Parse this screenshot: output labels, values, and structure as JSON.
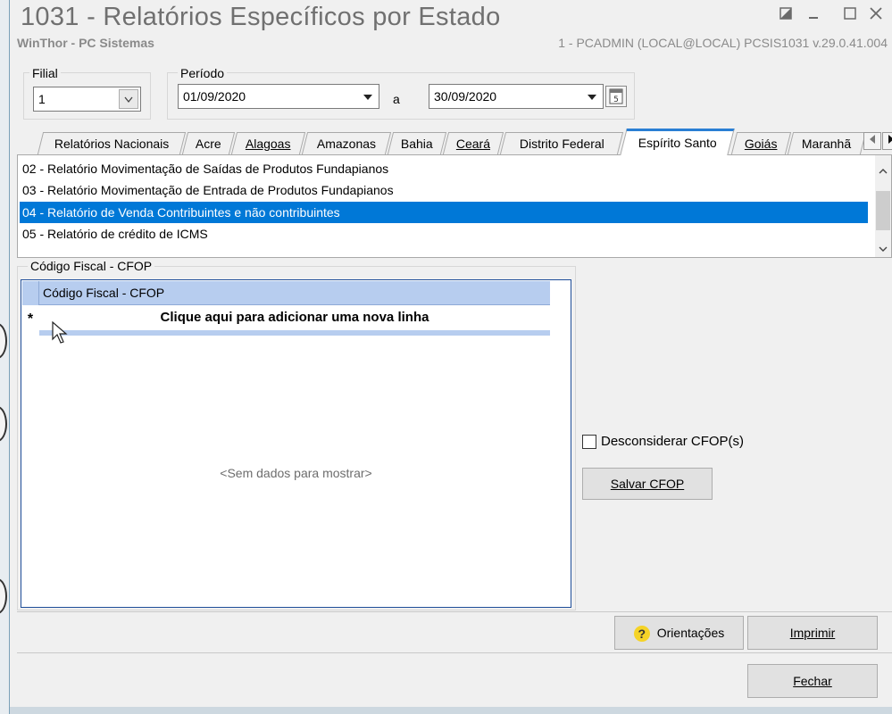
{
  "window": {
    "title": "1031 - Relatórios Específicos por Estado",
    "subtitle_left": "WinThor - PC Sistemas",
    "subtitle_right": "1 - PCADMIN (LOCAL@LOCAL)   PCSIS1031  v.29.0.41.004",
    "controls": [
      "restore-icon",
      "minimize-icon",
      "maximize-icon",
      "close-icon"
    ]
  },
  "filial": {
    "label": "Filial",
    "value": "1"
  },
  "periodo": {
    "label": "Período",
    "start": "01/09/2020",
    "separator": "a",
    "end": "30/09/2020"
  },
  "tabs": [
    {
      "label": "Relatórios Nacionais",
      "active": false
    },
    {
      "label": "Acre",
      "active": false
    },
    {
      "label": "Alagoas",
      "active": false
    },
    {
      "label": "Amazonas",
      "active": false
    },
    {
      "label": "Bahia",
      "active": false
    },
    {
      "label": "Ceará",
      "active": false
    },
    {
      "label": "Distrito Federal",
      "active": false
    },
    {
      "label": "Espírito Santo",
      "active": true
    },
    {
      "label": "Goiás",
      "active": false
    },
    {
      "label": "Maranhã",
      "active": false
    }
  ],
  "reports": [
    {
      "label": "02 - Relatório Movimentação de Saídas de Produtos Fundapianos",
      "selected": false
    },
    {
      "label": "03 - Relatório Movimentação de Entrada de Produtos Fundapianos",
      "selected": false
    },
    {
      "label": "04 - Relatório de Venda Contribuintes e não contribuintes",
      "selected": true
    },
    {
      "label": "05 - Relatório de crédito de ICMS",
      "selected": false
    }
  ],
  "cfop": {
    "group_label": "Código Fiscal - CFOP",
    "column_header": "Código Fiscal - CFOP",
    "new_row_marker": "*",
    "new_row_text": "Clique aqui para adicionar uma nova linha",
    "empty_text": "<Sem dados para mostrar>",
    "ignore_label": "Desconsiderar CFOP(s)",
    "ignore_checked": false,
    "save_label": "Salvar CFOP"
  },
  "buttons": {
    "help": "Orientações",
    "print": "Imprimir",
    "close": "Fechar"
  },
  "colors": {
    "selection": "#0078d7",
    "active_tab_accent": "#2a7fd4",
    "grid_header": "#b7cdef",
    "help_icon": "#f5d327"
  }
}
